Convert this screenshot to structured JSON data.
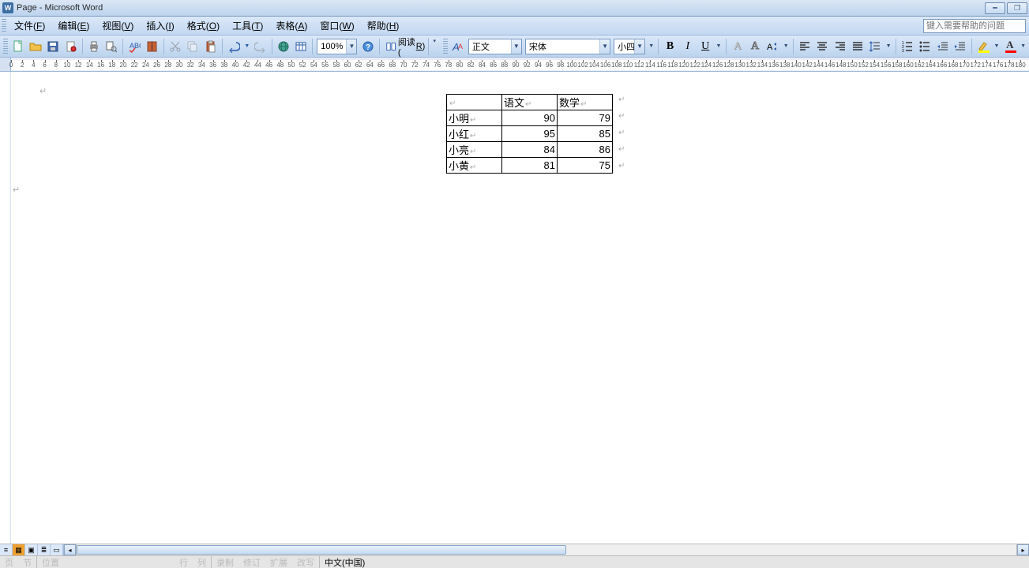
{
  "title": "Page - Microsoft Word",
  "menus": {
    "file": "文件(",
    "file_k": "F",
    "edit": "编辑(",
    "edit_k": "E",
    "view": "视图(",
    "view_k": "V",
    "insert": "插入(",
    "insert_k": "I",
    "format": "格式(",
    "format_k": "O",
    "tools": "工具(",
    "tools_k": "T",
    "table": "表格(",
    "table_k": "A",
    "window": "窗口(",
    "window_k": "W",
    "help": "帮助(",
    "help_k": "H",
    "close": ")"
  },
  "help_placeholder": "键入需要帮助的问题",
  "toolbar": {
    "zoom": "100%",
    "read": "阅读(",
    "read_k": "R",
    "style": "正文",
    "font": "宋体",
    "size": "小四",
    "b": "B",
    "i": "I",
    "u": "U",
    "a": "A",
    "highlight_color": "#ffff00",
    "font_color": "#ff0000"
  },
  "document": {
    "table": {
      "headers": [
        "",
        "语文",
        "数学"
      ],
      "rows": [
        {
          "name": "小明",
          "c1": "90",
          "c2": "79"
        },
        {
          "name": "小红",
          "c1": "95",
          "c2": "85"
        },
        {
          "name": "小亮",
          "c1": "84",
          "c2": "86"
        },
        {
          "name": "小黄",
          "c1": "81",
          "c2": "75"
        }
      ]
    }
  },
  "status": {
    "page": "页",
    "sec": "节",
    "pos": "位置",
    "line": "行",
    "col": "列",
    "rec": "录制",
    "rev": "修订",
    "ext": "扩展",
    "ovr": "改写",
    "lang": "中文(中国)"
  }
}
